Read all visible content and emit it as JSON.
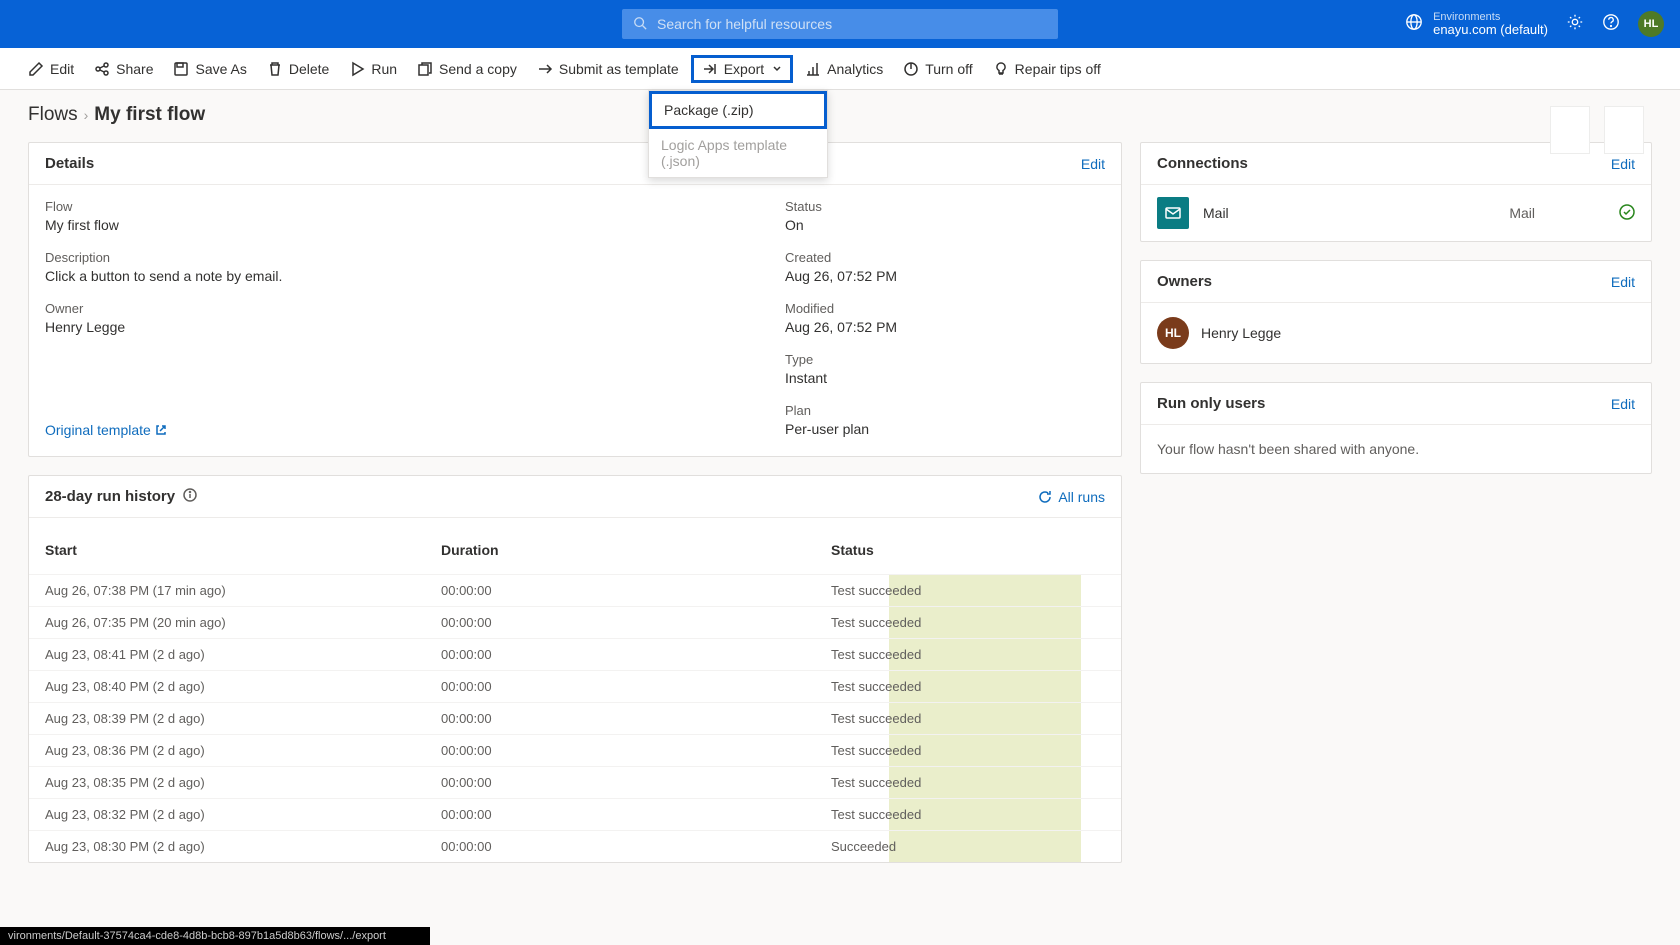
{
  "header": {
    "search_placeholder": "Search for helpful resources",
    "env_label": "Environments",
    "env_name": "enayu.com (default)",
    "avatar": "HL"
  },
  "commands": {
    "edit": "Edit",
    "share": "Share",
    "saveas": "Save As",
    "delete": "Delete",
    "run": "Run",
    "sendcopy": "Send a copy",
    "submittmpl": "Submit as template",
    "export": "Export",
    "analytics": "Analytics",
    "turnoff": "Turn off",
    "repair": "Repair tips off"
  },
  "export_menu": {
    "zip": "Package (.zip)",
    "json": "Logic Apps template (.json)"
  },
  "breadcrumb": {
    "root": "Flows",
    "current": "My first flow"
  },
  "details": {
    "title": "Details",
    "edit": "Edit",
    "flow_label": "Flow",
    "flow_value": "My first flow",
    "desc_label": "Description",
    "desc_value": "Click a button to send a note by email.",
    "owner_label": "Owner",
    "owner_value": "Henry Legge",
    "status_label": "Status",
    "status_value": "On",
    "created_label": "Created",
    "created_value": "Aug 26, 07:52 PM",
    "modified_label": "Modified",
    "modified_value": "Aug 26, 07:52 PM",
    "type_label": "Type",
    "type_value": "Instant",
    "plan_label": "Plan",
    "plan_value": "Per-user plan",
    "template_link": "Original template"
  },
  "history": {
    "title": "28-day run history",
    "allruns": "All runs",
    "cols": {
      "start": "Start",
      "duration": "Duration",
      "status": "Status"
    },
    "rows": [
      {
        "start": "Aug 26, 07:38 PM (17 min ago)",
        "dur": "00:00:00",
        "status": "Test succeeded"
      },
      {
        "start": "Aug 26, 07:35 PM (20 min ago)",
        "dur": "00:00:00",
        "status": "Test succeeded"
      },
      {
        "start": "Aug 23, 08:41 PM (2 d ago)",
        "dur": "00:00:00",
        "status": "Test succeeded"
      },
      {
        "start": "Aug 23, 08:40 PM (2 d ago)",
        "dur": "00:00:00",
        "status": "Test succeeded"
      },
      {
        "start": "Aug 23, 08:39 PM (2 d ago)",
        "dur": "00:00:00",
        "status": "Test succeeded"
      },
      {
        "start": "Aug 23, 08:36 PM (2 d ago)",
        "dur": "00:00:00",
        "status": "Test succeeded"
      },
      {
        "start": "Aug 23, 08:35 PM (2 d ago)",
        "dur": "00:00:00",
        "status": "Test succeeded"
      },
      {
        "start": "Aug 23, 08:32 PM (2 d ago)",
        "dur": "00:00:00",
        "status": "Test succeeded"
      },
      {
        "start": "Aug 23, 08:30 PM (2 d ago)",
        "dur": "00:00:00",
        "status": "Succeeded"
      }
    ]
  },
  "connections": {
    "title": "Connections",
    "edit": "Edit",
    "name": "Mail",
    "acct": "Mail"
  },
  "owners": {
    "title": "Owners",
    "edit": "Edit",
    "initials": "HL",
    "name": "Henry Legge"
  },
  "runonly": {
    "title": "Run only users",
    "edit": "Edit",
    "msg": "Your flow hasn't been shared with anyone."
  },
  "statusbar": "vironments/Default-37574ca4-cde8-4d8b-bcb8-897b1a5d8b63/flows/.../export"
}
